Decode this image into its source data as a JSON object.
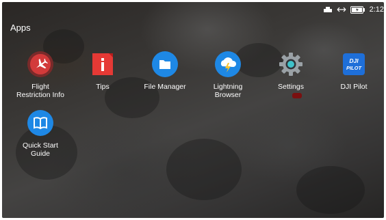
{
  "status_bar": {
    "time": "2:12",
    "icons": [
      "usb-icon",
      "sync-arrows-icon",
      "battery-icon"
    ]
  },
  "launcher": {
    "title": "Apps",
    "apps": [
      {
        "label": "Flight\nRestriction Info",
        "icon": "airplane-icon",
        "color": "#d23a3a"
      },
      {
        "label": "Tips",
        "icon": "tips-icon",
        "color": "#e53935"
      },
      {
        "label": "File Manager",
        "icon": "folder-icon",
        "color": "#1e88e5"
      },
      {
        "label": "Lightning\nBrowser",
        "icon": "lightning-cloud-icon",
        "color": "#1e88e5"
      },
      {
        "label": "Settings",
        "icon": "gear-icon",
        "color": "#9aa1a6"
      },
      {
        "label": "DJI Pilot",
        "icon": "dji-pilot-icon",
        "color": "#1e6fd9",
        "icon_text": "DJI\nPILOT"
      },
      {
        "label": "Quick Start\nGuide",
        "icon": "book-icon",
        "color": "#1e88e5"
      }
    ]
  }
}
